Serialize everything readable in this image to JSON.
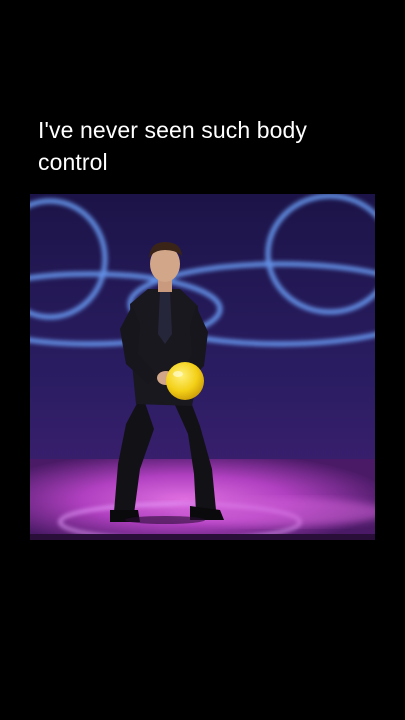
{
  "post": {
    "caption": "I've never seen such body control"
  },
  "video": {
    "scene": "performer-on-stage",
    "colors": {
      "background_top": "#1b1546",
      "background_bottom": "#2a1a5c",
      "ring_glow": "#6aa8ff",
      "floor": "#c04cc8",
      "ball": "#f5d21a",
      "suit": "#141418"
    }
  }
}
